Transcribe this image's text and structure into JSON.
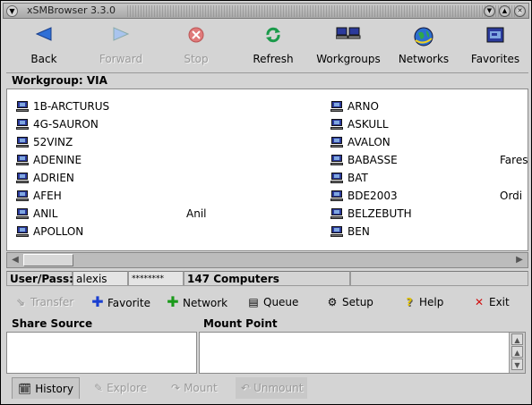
{
  "window": {
    "title": "xSMBrowser 3.3.0"
  },
  "toolbar": {
    "back": {
      "label": "Back",
      "icon": "back-arrow-icon",
      "enabled": true
    },
    "forward": {
      "label": "Forward",
      "icon": "forward-arrow-icon",
      "enabled": false
    },
    "stop": {
      "label": "Stop",
      "icon": "stop-icon",
      "enabled": false
    },
    "refresh": {
      "label": "Refresh",
      "icon": "refresh-icon",
      "enabled": true
    },
    "workgroups": {
      "label": "Workgroups",
      "icon": "workgroups-icon",
      "enabled": true
    },
    "networks": {
      "label": "Networks",
      "icon": "globe-icon",
      "enabled": true
    },
    "favorites": {
      "label": "Favorites",
      "icon": "favorites-icon",
      "enabled": true
    }
  },
  "workgroup": {
    "label": "Workgroup: VIA"
  },
  "computers_left": [
    {
      "name": "1B-ARCTURUS",
      "comment": ""
    },
    {
      "name": "4G-SAURON",
      "comment": ""
    },
    {
      "name": "52VINZ",
      "comment": ""
    },
    {
      "name": "ADENINE",
      "comment": ""
    },
    {
      "name": "ADRIEN",
      "comment": ""
    },
    {
      "name": "AFEH",
      "comment": ""
    },
    {
      "name": "ANIL",
      "comment": "Anil"
    },
    {
      "name": "APOLLON",
      "comment": ""
    }
  ],
  "computers_right": [
    {
      "name": "ARNO",
      "comment": ""
    },
    {
      "name": "ASKULL",
      "comment": ""
    },
    {
      "name": "AVALON",
      "comment": ""
    },
    {
      "name": "BABASSE",
      "comment": "Fares"
    },
    {
      "name": "BAT",
      "comment": ""
    },
    {
      "name": "BDE2003",
      "comment": "Ordi"
    },
    {
      "name": "BELZEBUTH",
      "comment": ""
    },
    {
      "name": "BEN",
      "comment": ""
    }
  ],
  "status": {
    "user_pass_label": "User/Pass:",
    "username": "alexis",
    "password_mask": "********",
    "computer_count": "147 Computers"
  },
  "actions": {
    "transfer": "Transfer",
    "favorite": "Favorite",
    "network": "Network",
    "queue": "Queue",
    "setup": "Setup",
    "help": "Help",
    "exit": "Exit"
  },
  "panes": {
    "share_source": "Share Source",
    "mount_point": "Mount Point"
  },
  "bottom_tabs": {
    "history": "History",
    "explore": "Explore",
    "mount": "Mount",
    "unmount": "Unmount"
  },
  "colors": {
    "window_bg": "#d4d4d4",
    "list_bg": "#ffffff",
    "favorite_icon": "#1a3fd0",
    "network_icon": "#1a9a1a",
    "exit_icon": "#d01010",
    "help_icon": "#e0c000"
  }
}
